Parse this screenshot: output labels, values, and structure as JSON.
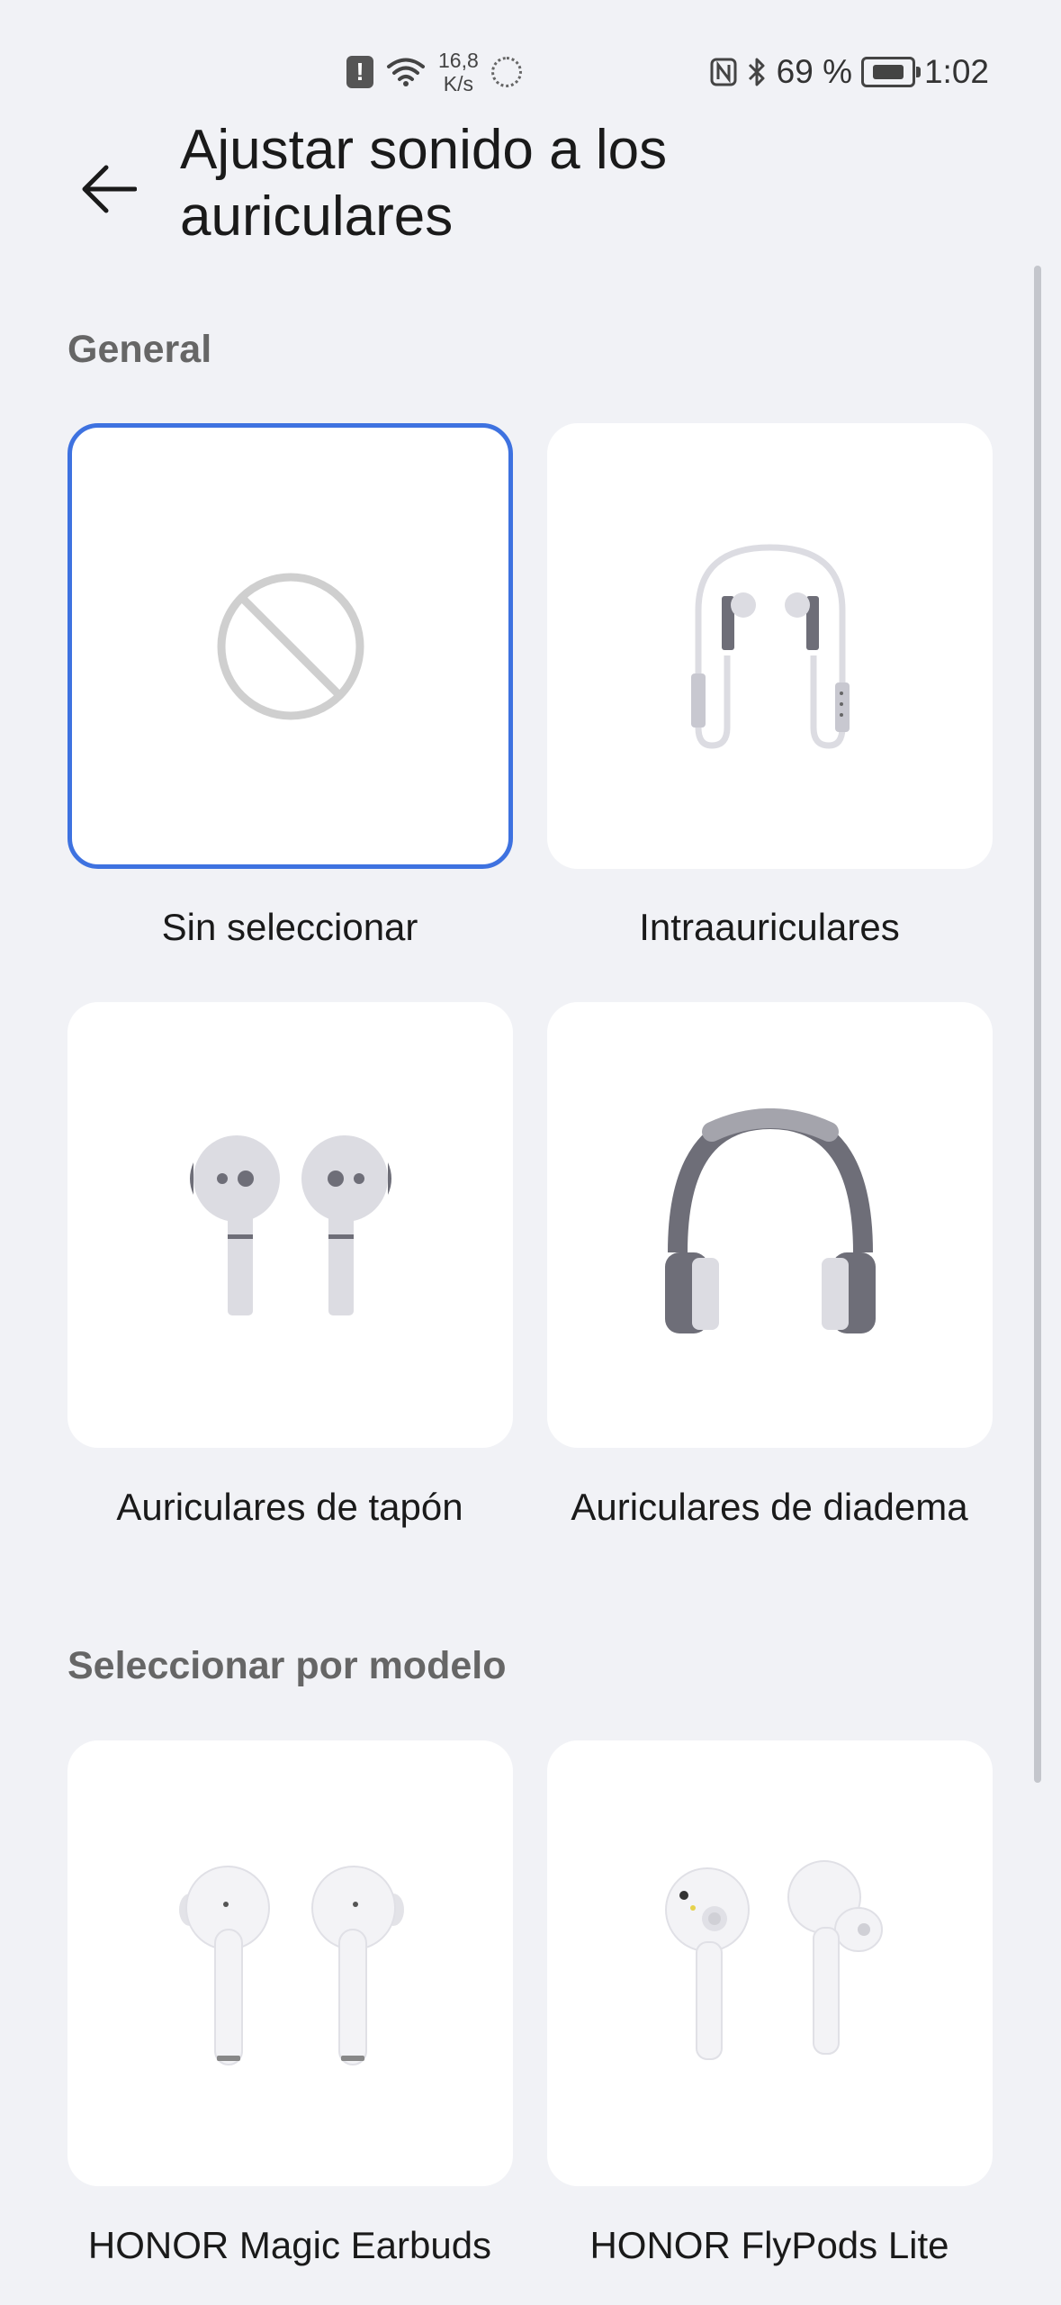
{
  "status_bar": {
    "alert_icon": "!",
    "speed_value": "16,8",
    "speed_unit": "K/s",
    "battery_percent": "69 %",
    "time": "1:02"
  },
  "header": {
    "back_icon": "arrow-left-icon",
    "title": "Ajustar sonido a los auriculares"
  },
  "sections": {
    "general": {
      "title": "General",
      "options": [
        {
          "label": "Sin seleccionar",
          "selected": true,
          "icon": "no-selection-icon"
        },
        {
          "label": "Intraauriculares",
          "selected": false,
          "icon": "neckband-earphones-icon"
        },
        {
          "label": "Auriculares de tapón",
          "selected": false,
          "icon": "earbuds-icon"
        },
        {
          "label": "Auriculares de diadema",
          "selected": false,
          "icon": "headphones-icon"
        }
      ]
    },
    "model": {
      "title": "Seleccionar por modelo",
      "options": [
        {
          "label": "HONOR Magic Earbuds",
          "icon": "honor-magic-earbuds-image"
        },
        {
          "label": "HONOR FlyPods Lite",
          "icon": "honor-flypods-lite-image"
        }
      ]
    }
  },
  "colors": {
    "background": "#f1f2f6",
    "card": "#ffffff",
    "selected_border": "#3e72e0",
    "section_title": "#666666"
  }
}
